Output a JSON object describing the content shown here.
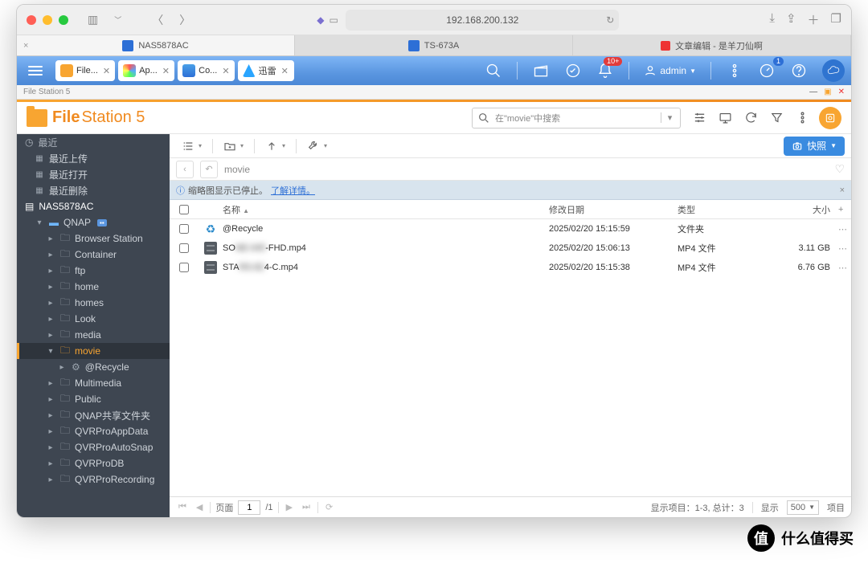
{
  "browser": {
    "url": "192.168.200.132",
    "tabs": [
      {
        "label": "NAS5878AC",
        "active": true
      },
      {
        "label": "TS-673A",
        "active": false
      },
      {
        "label": "文章编辑 - 是羊刀仙啊",
        "active": false
      }
    ]
  },
  "qts": {
    "tabs": [
      {
        "label": "File...",
        "icon_bg": "#f8a531"
      },
      {
        "label": "Ap...",
        "icon_bg": "linear-gradient(45deg,#f55,#5af,#5f5,#ff5)"
      },
      {
        "label": "Co...",
        "icon_bg": "#2d6fd6"
      },
      {
        "label": "迅雷",
        "icon_bg": "#2aa5ff"
      }
    ],
    "notif_badge": "10+",
    "dash_badge": "1",
    "user": "admin"
  },
  "window_title": "File Station 5",
  "app": {
    "name_a": "File",
    "name_b": "Station 5",
    "search_placeholder": "在\"movie\"中搜索",
    "snapshot_btn": "快照"
  },
  "sidebar": {
    "recent": "最近",
    "recent_upload": "最近上传",
    "recent_open": "最近打开",
    "recent_delete": "最近删除",
    "nas": "NAS5878AC",
    "volume": "QNAP",
    "folders": [
      "Browser Station",
      "Container",
      "ftp",
      "home",
      "homes",
      "Look",
      "media",
      "movie",
      "Multimedia",
      "Public",
      "QNAP共享文件夹",
      "QVRProAppData",
      "QVRProAutoSnap",
      "QVRProDB",
      "QVRProRecording"
    ],
    "recycle_sub": "@Recycle",
    "selected": "movie"
  },
  "breadcrumb": "movie",
  "banner": {
    "text": "缩略图显示已停止。",
    "link": "了解详情。"
  },
  "columns": {
    "name": "名称",
    "date": "修改日期",
    "type": "类型",
    "size": "大小"
  },
  "files": [
    {
      "icon": "recycle",
      "name": "@Recycle",
      "blur": "",
      "date": "2025/02/20 15:15:59",
      "type": "文件夹",
      "size": ""
    },
    {
      "icon": "video",
      "name": "SO",
      "blur": "NE-045",
      "suffix": "-FHD.mp4",
      "date": "2025/02/20 15:06:13",
      "type": "MP4 文件",
      "size": "3.11 GB"
    },
    {
      "icon": "video",
      "name": "STA",
      "blur": "RS-82",
      "suffix": "4-C.mp4",
      "date": "2025/02/20 15:15:38",
      "type": "MP4 文件",
      "size": "6.76 GB"
    }
  ],
  "status": {
    "page_label": "页面",
    "page": "1",
    "total_pages": "/1",
    "summary": "显示项目：1-3, 总计：3",
    "show_label": "显示",
    "page_size": "500",
    "items_label": "项目"
  },
  "watermark": "什么值得买"
}
